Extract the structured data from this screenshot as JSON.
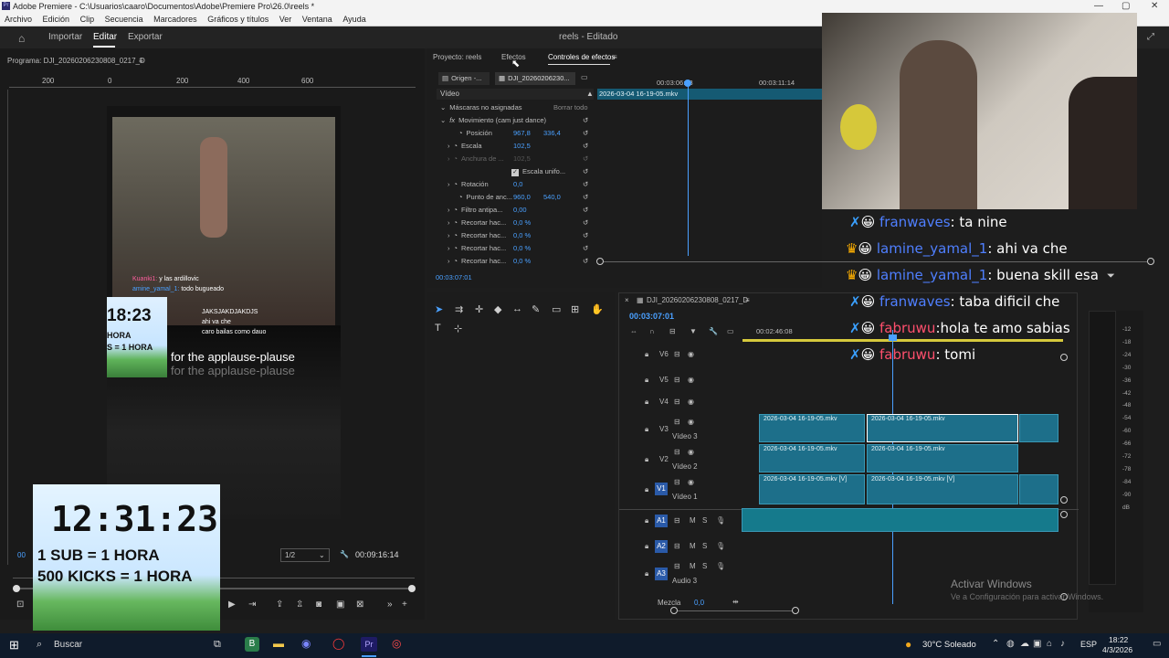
{
  "titlebar": {
    "title": "Adobe Premiere - C:\\Usuarios\\caaro\\Documentos\\Adobe\\Premiere Pro\\26.0\\reels *"
  },
  "menu": [
    "Archivo",
    "Edición",
    "Clip",
    "Secuencia",
    "Marcadores",
    "Gráficos y títulos",
    "Ver",
    "Ventana",
    "Ayuda"
  ],
  "header": {
    "import": "Importar",
    "edit": "Editar",
    "export": "Exportar",
    "project_status": "reels - Editado"
  },
  "program": {
    "title": "Programa: DJI_20260206230808_0217_D",
    "ruler": [
      "200",
      "0",
      "200",
      "400",
      "600"
    ],
    "timecode_left": "00",
    "fraction": "1/2",
    "timecode_right": "00:09:16:14"
  },
  "overlay_small": {
    "timer": "18:23",
    "line1": "HORA",
    "line2": "S = 1 HORA"
  },
  "overlay_chat": {
    "l1_user": "Kuanki1:",
    "l1_msg": "y las ardillovic",
    "l2_user": "amine_yamal_1:",
    "l2_msg": "todo bugueado",
    "l3": "JAKSJAKDJAKDJS",
    "l4": "ahi va che",
    "l5": "caro bailas como dauo"
  },
  "subtitles": {
    "line1": "for the applause-plause",
    "line2": "for the applause-plause"
  },
  "big_overlay": {
    "timer": "12:31:23",
    "line1": "1 SUB = 1 HORA",
    "line2": "500 KICKS = 1 HORA"
  },
  "tabs": {
    "project": "Proyecto: reels",
    "effects": "Efectos",
    "effect_controls": "Controles de efectos"
  },
  "effect_controls": {
    "source_origin": "Origen -...",
    "source_clip": "DJI_20260206230...",
    "ruler_a": "00:03:06:03",
    "ruler_b": "00:03:11:14",
    "clip_bar": "2026-03-04 16-19-05.mkv",
    "section": "Vídeo",
    "rows": [
      {
        "label": "Máscaras no asignadas",
        "extra": "Borrar todo"
      },
      {
        "label": "Movimiento (cam just dance)",
        "extra": ""
      },
      {
        "label": "Posición",
        "v1": "967,8",
        "v2": "336,4"
      },
      {
        "label": "Escala",
        "v1": "102,5",
        "v2": ""
      },
      {
        "label": "Anchura de ...",
        "v1": "102,5",
        "v2": ""
      },
      {
        "label": "Escala unifo...",
        "v1": "",
        "v2": ""
      },
      {
        "label": "Rotación",
        "v1": "0,0",
        "v2": ""
      },
      {
        "label": "Punto de anc...",
        "v1": "960,0",
        "v2": "540,0"
      },
      {
        "label": "Filtro antipa...",
        "v1": "0,00",
        "v2": ""
      },
      {
        "label": "Recortar hac...",
        "v1": "0,0 %",
        "v2": ""
      },
      {
        "label": "Recortar hac...",
        "v1": "0,0 %",
        "v2": ""
      },
      {
        "label": "Recortar hac...",
        "v1": "0,0 %",
        "v2": ""
      },
      {
        "label": "Recortar hac...",
        "v1": "0,0 %",
        "v2": ""
      }
    ],
    "timecode": "00:03:07:01"
  },
  "timeline": {
    "seq_name": "DJI_20260206230808_0217_D",
    "timecode": "00:03:07:01",
    "ruler_a": "00:02:46:08",
    "tracks": [
      {
        "id": "V6",
        "name": ""
      },
      {
        "id": "V5",
        "name": ""
      },
      {
        "id": "V4",
        "name": ""
      },
      {
        "id": "V3",
        "name": "Vídeo 3"
      },
      {
        "id": "V2",
        "name": "Vídeo 2"
      },
      {
        "id": "V1",
        "name": "Vídeo 1"
      },
      {
        "id": "A1",
        "name": ""
      },
      {
        "id": "A2",
        "name": ""
      },
      {
        "id": "A3",
        "name": "Audio 3"
      }
    ],
    "mix_label": "Mezcla",
    "mix_value": "0,0",
    "clips": {
      "v3a": "2026-03-04 16-19-05.mkv",
      "v3b": "2026-03-04 16-19-05.mkv",
      "v2a": "2026-03-04 16-19-05.mkv",
      "v2b": "2026-03-04 16-19-05.mkv",
      "v1a": "2026-03-04 16-19-05.mkv [V]",
      "v1b": "2026-03-04 16-19-05.mkv [V]"
    }
  },
  "meter_scale": [
    "-12",
    "-18",
    "-24",
    "-30",
    "-36",
    "-42",
    "-48",
    "-54",
    "-60",
    "-66",
    "-72",
    "-78",
    "-84",
    "-90",
    "dB"
  ],
  "stream_chat": [
    {
      "user": "franwaves",
      "msg": ": ta nine",
      "color": "blue"
    },
    {
      "user": "lamine_yamal_1",
      "msg": ": ahi va che",
      "color": "blue"
    },
    {
      "user": "lamine_yamal_1",
      "msg": ": buena skill esa",
      "color": "blue"
    },
    {
      "user": "franwaves",
      "msg": ": taba dificil che",
      "color": "blue"
    },
    {
      "user": "fabruwu",
      "msg": ":hola te amo sabias",
      "color": "red"
    },
    {
      "user": "fabruwu",
      "msg": ": tomi",
      "color": "red"
    }
  ],
  "watermark": {
    "line1": "Activar Windows",
    "line2": "Ve a Configuración para activar Windows."
  },
  "taskbar": {
    "search": "Buscar",
    "weather": "30°C Soleado",
    "lang": "ESP",
    "time": "18:22",
    "date": "4/3/2026"
  }
}
